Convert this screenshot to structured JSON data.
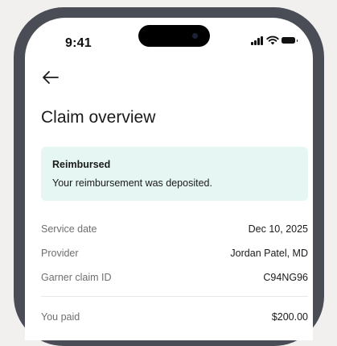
{
  "status_bar": {
    "time": "9:41",
    "icons": [
      "cellular-signal-icon",
      "wifi-icon",
      "battery-icon"
    ]
  },
  "navigation": {
    "back_icon": "arrow-left-icon"
  },
  "page": {
    "title": "Claim overview"
  },
  "claim_status": {
    "title": "Reimbursed",
    "message": "Your reimbursement was deposited.",
    "background_color": "#e6f6f2"
  },
  "details": [
    {
      "label": "Service date",
      "value": "Dec 10, 2025"
    },
    {
      "label": "Provider",
      "value": "Jordan Patel, MD"
    },
    {
      "label": "Garner claim ID",
      "value": "C94NG96"
    }
  ],
  "payment": {
    "label": "You paid",
    "value": "$200.00"
  }
}
